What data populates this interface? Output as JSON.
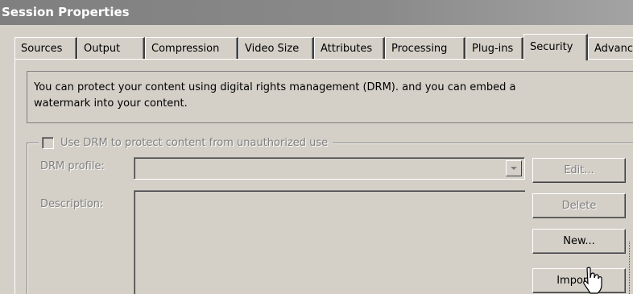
{
  "window": {
    "title": "Session Properties"
  },
  "tabs": [
    {
      "label": "Sources"
    },
    {
      "label": "Output"
    },
    {
      "label": "Compression"
    },
    {
      "label": "Video Size"
    },
    {
      "label": "Attributes"
    },
    {
      "label": "Processing"
    },
    {
      "label": "Plug-ins"
    },
    {
      "label": "Security",
      "active": true
    },
    {
      "label": "Advance"
    }
  ],
  "info": {
    "text_line1": "You can protect your content using digital rights management (DRM). and you can embed a",
    "text_line2": "watermark into your content."
  },
  "drm": {
    "checkbox_label": "Use DRM to protect content from unauthorized use",
    "checked": false,
    "profile_label": "DRM profile:",
    "profile_value": "",
    "description_label": "Description:",
    "description_value": ""
  },
  "buttons": {
    "edit": "Edit...",
    "delete": "Delete",
    "new": "New...",
    "import": "Import..."
  },
  "icons": {
    "cursor": "hand-pointer-icon",
    "dropdown": "chevron-down-icon"
  }
}
